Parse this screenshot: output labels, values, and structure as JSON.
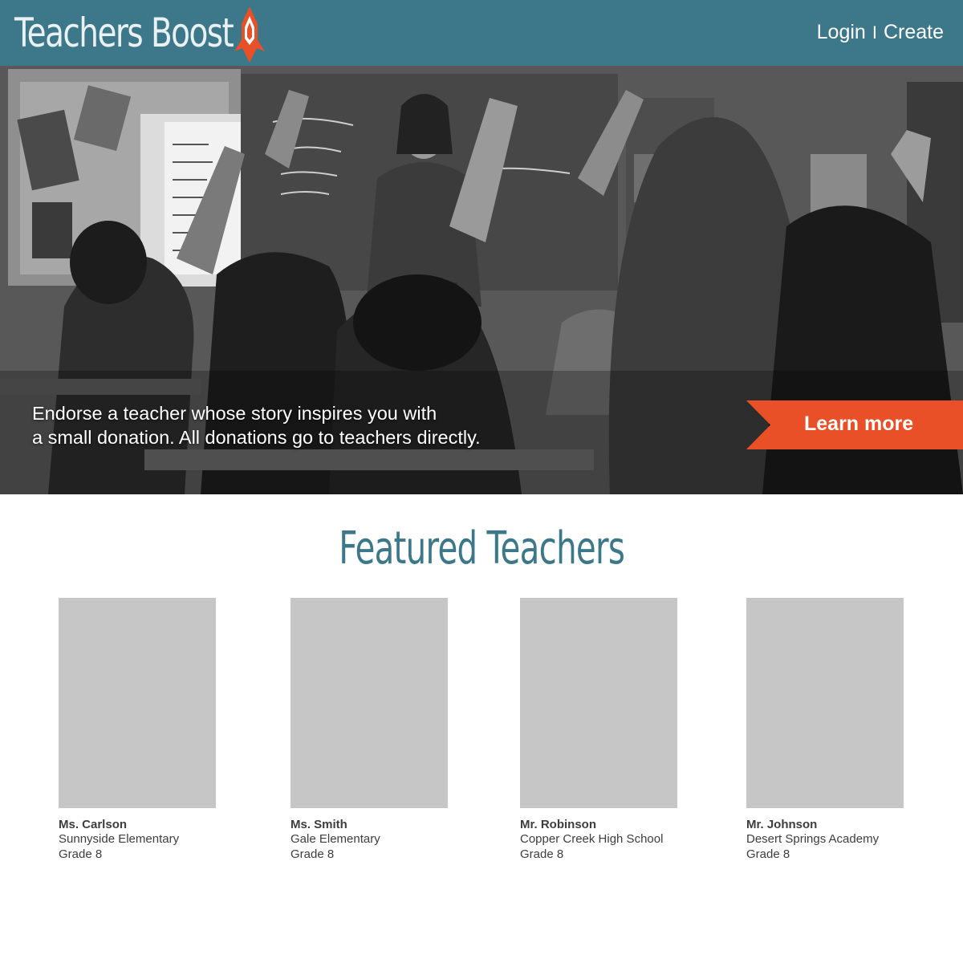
{
  "header": {
    "logo_text": "Teachers Boost",
    "login_label": "Login",
    "separator": "I",
    "create_label": "Create"
  },
  "hero": {
    "tagline_line1": "Endorse a teacher whose story inspires you with",
    "tagline_line2": "a small donation. All donations go to teachers directly.",
    "cta_label": "Learn more"
  },
  "featured": {
    "title": "Featured Teachers",
    "teachers": [
      {
        "name": "Ms. Carlson",
        "school": "Sunnyside Elementary",
        "grade": "Grade 8"
      },
      {
        "name": "Ms. Smith",
        "school": "Gale Elementary",
        "grade": "Grade 8"
      },
      {
        "name": "Mr. Robinson",
        "school": "Copper Creek High School",
        "grade": "Grade 8"
      },
      {
        "name": "Mr. Johnson",
        "school": "Desert Springs Academy",
        "grade": "Grade 8"
      }
    ]
  },
  "colors": {
    "header_bg": "#3c7889",
    "accent_orange": "#ea5027",
    "photo_placeholder": "#c6c6c6"
  }
}
